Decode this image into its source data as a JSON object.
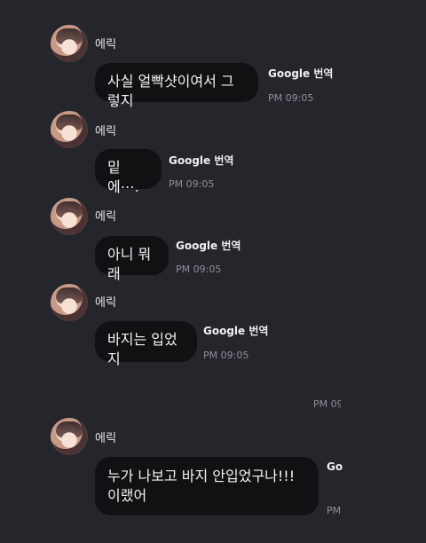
{
  "messages": [
    {
      "sender": "에릭",
      "text": "사실 얼빡샷이여서 그렇지",
      "translate": "Google 번역",
      "time": "PM 09:05"
    },
    {
      "sender": "에릭",
      "text": "밑에⋯.",
      "translate": "Google 번역",
      "time": "PM 09:05"
    },
    {
      "sender": "에릭",
      "text": "아니 뭐래",
      "translate": "Google 번역",
      "time": "PM 09:05"
    },
    {
      "sender": "에릭",
      "text": "바지는 입었지",
      "translate": "Google 번역",
      "time": "PM 09:05"
    },
    {
      "sender": "",
      "text": "",
      "translate": "",
      "time": "PM 09"
    },
    {
      "sender": "에릭",
      "text": "누가 나보고 바지 안입었구나!!! 이랬어",
      "translate": "Go",
      "time": "PM"
    }
  ]
}
